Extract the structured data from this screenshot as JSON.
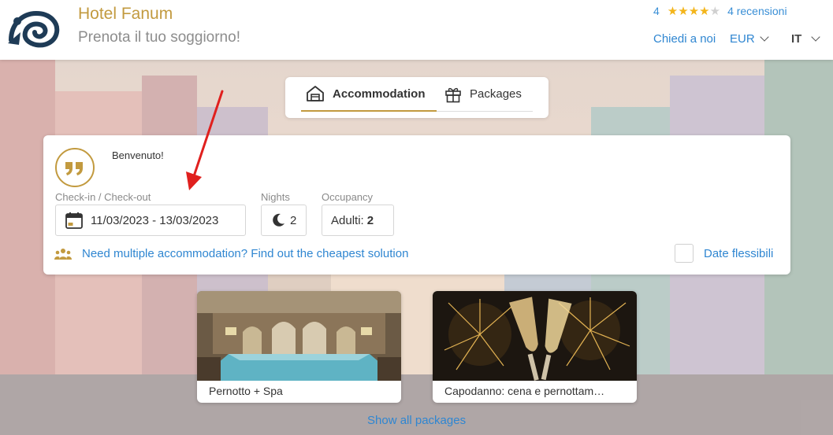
{
  "header": {
    "hotel_name": "Hotel Fanum",
    "tagline": "Prenota il tuo soggiorno!",
    "rating_value": "4",
    "rating_stars": 4,
    "rating_max": 5,
    "reviews_link": "4 recensioni",
    "contact_link": "Chiedi a noi",
    "currency": "EUR",
    "language": "IT"
  },
  "tabs": [
    {
      "label": "Accommodation",
      "icon": "house-icon",
      "active": true
    },
    {
      "label": "Packages",
      "icon": "gift-icon",
      "active": false
    }
  ],
  "booking": {
    "welcome": "Benvenuto!",
    "dates_label": "Check-in / Check-out",
    "dates_value": "11/03/2023 - 13/03/2023",
    "nights_label": "Nights",
    "nights_value": "2",
    "occupancy_label": "Occupancy",
    "occupancy_prefix": "Adulti:",
    "occupancy_value": "2",
    "multi_link": "Need multiple accommodation? Find out the cheapest solution",
    "flexible_label": "Date flessibili"
  },
  "packages": [
    {
      "title": "Pernotto + Spa"
    },
    {
      "title": "Capodanno: cena e pernottam…"
    }
  ],
  "show_all": "Show all packages",
  "colors": {
    "brand_gold": "#c29a3f",
    "link_blue": "#2f86d1",
    "star_yellow": "#f3b51b",
    "arrow_red": "#e0201e"
  }
}
